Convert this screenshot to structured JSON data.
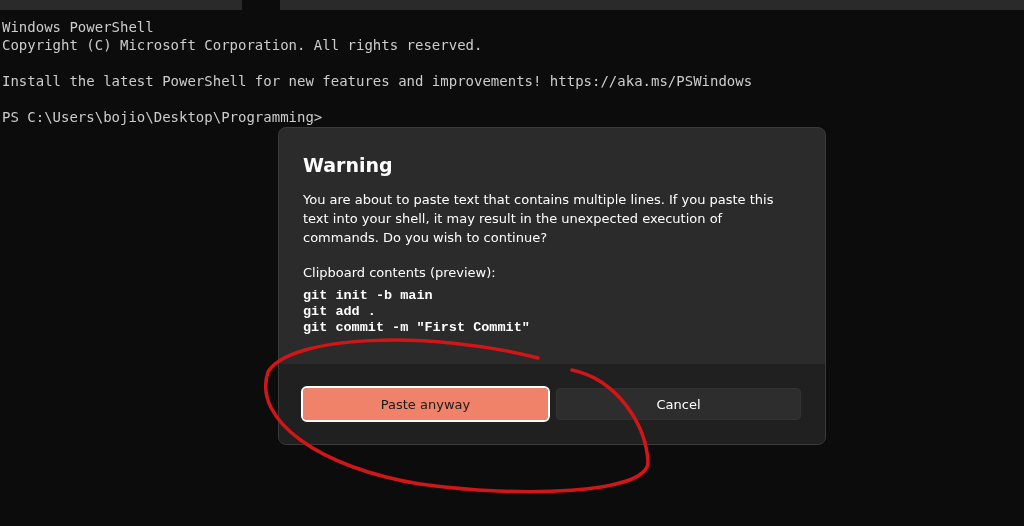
{
  "terminal": {
    "blocks": [
      [
        "Windows PowerShell",
        "Copyright (C) Microsoft Corporation. All rights reserved."
      ],
      [
        "Install the latest PowerShell for new features and improvements! https://aka.ms/PSWindows"
      ],
      [
        "PS C:\\Users\\bojio\\Desktop\\Programming>"
      ]
    ]
  },
  "dialog": {
    "title": "Warning",
    "message": "You are about to paste text that contains multiple lines. If you paste this text into your shell, it may result in the unexpected execution of commands. Do you wish to continue?",
    "preview_label": "Clipboard contents (preview):",
    "preview_lines": [
      "git init -b main",
      "git add .",
      "git commit -m \"First Commit\""
    ],
    "buttons": [
      {
        "label": "Paste anyway",
        "kind": "primary",
        "selected": true
      },
      {
        "label": "Cancel",
        "kind": "secondary",
        "selected": false
      }
    ]
  }
}
